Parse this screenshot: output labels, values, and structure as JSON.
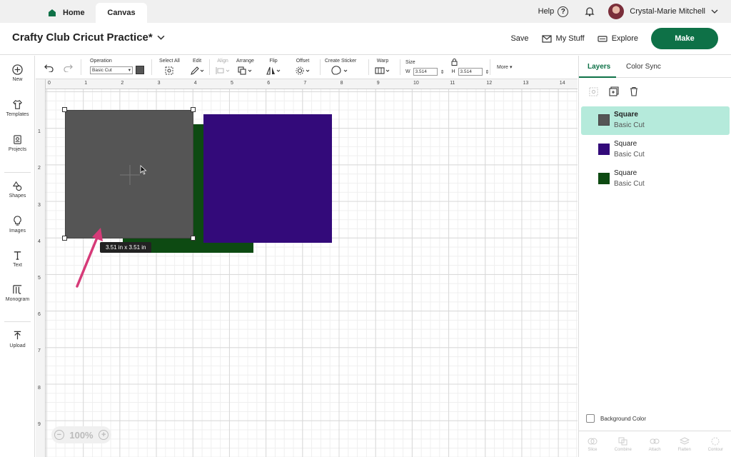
{
  "tabs": {
    "home": "Home",
    "canvas": "Canvas"
  },
  "user": {
    "help": "Help",
    "name": "Crystal-Marie Mitchell"
  },
  "header": {
    "title": "Crafty Club Cricut Practice*",
    "save": "Save",
    "my_stuff": "My Stuff",
    "explore": "Explore",
    "make": "Make"
  },
  "sidebar": [
    {
      "label": "New",
      "icon": "plus-circle-icon"
    },
    {
      "label": "Templates",
      "icon": "shirt-icon"
    },
    {
      "label": "Projects",
      "icon": "projects-icon"
    },
    {
      "label": "Shapes",
      "icon": "shapes-icon"
    },
    {
      "label": "Images",
      "icon": "lightbulb-icon"
    },
    {
      "label": "Text",
      "icon": "text-icon"
    },
    {
      "label": "Monogram",
      "icon": "monogram-icon"
    },
    {
      "label": "Upload",
      "icon": "upload-icon"
    }
  ],
  "toolbar": {
    "operation_label": "Operation",
    "operation_value": "Basic Cut",
    "select_all": "Select All",
    "edit": "Edit",
    "align": "Align",
    "arrange": "Arrange",
    "flip": "Flip",
    "offset": "Offset",
    "create_sticker": "Create Sticker",
    "warp": "Warp",
    "size": "Size",
    "w_label": "W",
    "w_value": "3.514",
    "h_label": "H",
    "h_value": "3.514",
    "more": "More"
  },
  "ruler": {
    "top": [
      "0",
      "1",
      "2",
      "3",
      "4",
      "5",
      "6",
      "7",
      "8",
      "9",
      "10",
      "11",
      "12",
      "13",
      "14"
    ],
    "left": [
      "1",
      "2",
      "3",
      "4",
      "5",
      "6",
      "7",
      "8",
      "9"
    ]
  },
  "canvas": {
    "dimension_label": "3.51  in x 3.51  in",
    "zoom": "100%"
  },
  "colors": {
    "gray": "#555555",
    "purple": "#330a7a",
    "green": "#0d4a12",
    "arrow": "#d63a78",
    "brand": "#0e7147"
  },
  "right_panel": {
    "tabs": [
      "Layers",
      "Color Sync"
    ],
    "layers": [
      {
        "name": "Square",
        "sub": "Basic Cut",
        "color": "#555555"
      },
      {
        "name": "Square",
        "sub": "Basic Cut",
        "color": "#330a7a"
      },
      {
        "name": "Square",
        "sub": "Basic Cut",
        "color": "#0d4a12"
      }
    ],
    "background_color": "Background Color",
    "bottom_tools": [
      "Slice",
      "Combine",
      "Attach",
      "Flatten",
      "Contour"
    ]
  }
}
